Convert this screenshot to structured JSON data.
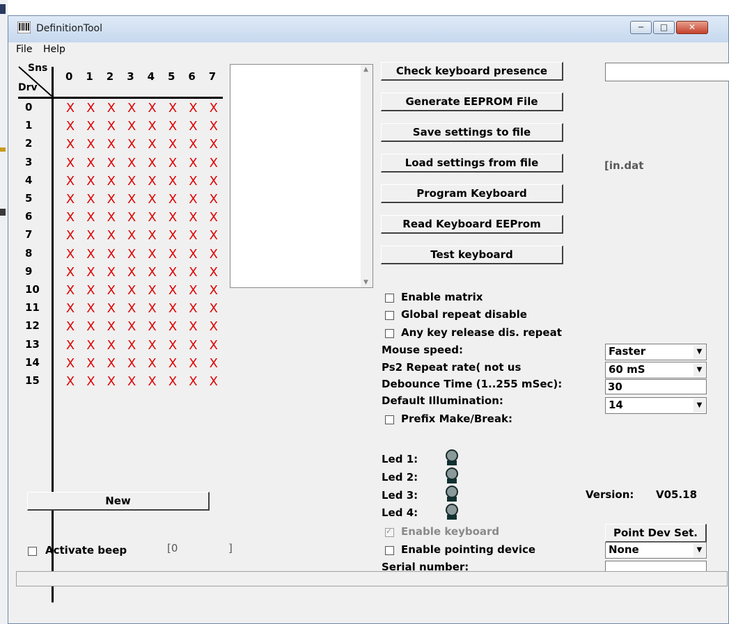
{
  "window": {
    "title": "DefinitionTool"
  },
  "menu": [
    "File",
    "Help"
  ],
  "matrix": {
    "sns_label": "Sns",
    "drv_label": "Drv",
    "columns": [
      "0",
      "1",
      "2",
      "3",
      "4",
      "5",
      "6",
      "7"
    ],
    "rows": [
      "0",
      "1",
      "2",
      "3",
      "4",
      "5",
      "6",
      "7",
      "8",
      "9",
      "10",
      "11",
      "12",
      "13",
      "14",
      "15"
    ],
    "cell_mark": "X"
  },
  "buttons": {
    "check": "Check keyboard presence",
    "generate": "Generate EEPROM File",
    "save": "Save settings to file",
    "load": "Load settings from file",
    "program": "Program Keyboard",
    "read": "Read Keyboard EEProm",
    "test": "Test keyboard",
    "new": "New",
    "pointdev": "Point Dev Set."
  },
  "filename": "[in.dat",
  "options": {
    "enable_matrix": "Enable matrix",
    "global_repeat": "Global repeat disable",
    "anykey": "Any key release dis. repeat",
    "prefix": "Prefix Make/Break:",
    "enable_keyboard": "Enable keyboard",
    "enable_pointing": "Enable pointing device",
    "activate_beep": "Activate beep"
  },
  "settings": {
    "mouse_speed_label": "Mouse speed:",
    "mouse_speed": "Faster",
    "repeat_label": "Ps2 Repeat rate( not us",
    "repeat": "60 mS",
    "debounce_label": "Debounce Time (1..255 mSec):",
    "debounce": "30",
    "illum_label": "Default Illumination:",
    "illum": "14",
    "pointdev": "None",
    "serial_label": "Serial number:"
  },
  "leds": [
    "Led 1:",
    "Led 2:",
    "Led 3:",
    "Led 4:"
  ],
  "version_label": "Version:",
  "version": "V05.18",
  "beep_value": "[0",
  "beep_bracket": "]",
  "colors": {
    "x_mark": "#e00000",
    "led_body": "#8a9a9a"
  }
}
